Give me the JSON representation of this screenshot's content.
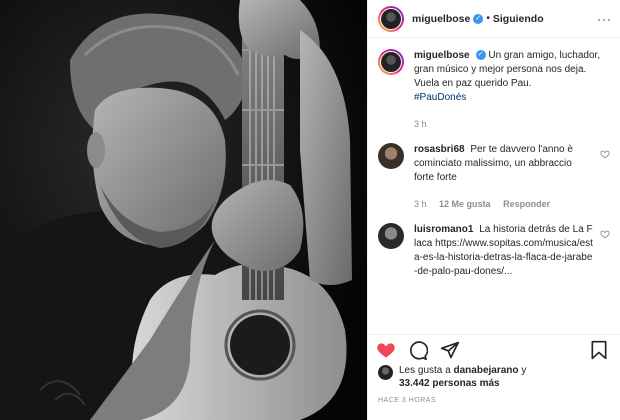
{
  "post": {
    "username": "miguelbose",
    "verified_mark": "✓",
    "separator": "•",
    "follow_status": "Siguiendo",
    "more_label": "···"
  },
  "caption": {
    "username": "miguelbose",
    "text": "Un gran amigo, luchador, gran músico y mejor persona nos deja. Vuela en paz querido Pau.",
    "hashtag": "#PauDonés",
    "time": "3 h"
  },
  "comments": [
    {
      "username": "rosasbri68",
      "text": "Per te davvero l'anno è cominciato malissimo, un abbraccio forte forte",
      "time": "3 h",
      "likes": "12 Me gusta",
      "reply": "Responder"
    },
    {
      "username": "luisromano1",
      "text": "La historia detrás de La Flaca https://www.sopitas.com/musica/esta-es-la-historia-detras-la-flaca-de-jarabe-de-palo-pau-dones/..."
    }
  ],
  "likes": {
    "prefix": "Les gusta a",
    "user": "danabejarano",
    "middle": "y",
    "count": "33.442 personas más"
  },
  "time_ago": "HACE 3 HORAS",
  "icons": {
    "like": "heart-icon",
    "comment": "comment-icon",
    "share": "share-icon",
    "save": "bookmark-icon",
    "like_color": "#ed4956"
  }
}
